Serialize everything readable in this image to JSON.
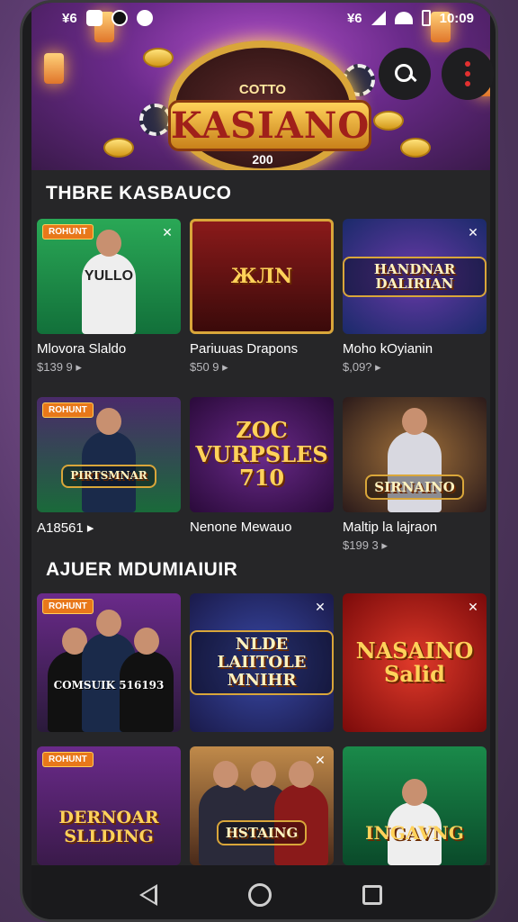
{
  "status_bar": {
    "left_text": "¥6",
    "time": "10:09",
    "right_text": "¥6",
    "icons": [
      "app-icon",
      "record-icon",
      "settings-icon",
      "signal-icon",
      "wifi-icon",
      "battery-icon"
    ]
  },
  "hero": {
    "logo_small": "COTTO",
    "logo_main": "KASIANO",
    "logo_badge": "200"
  },
  "actions": {
    "search_icon": "search-icon",
    "menu_icon": "more-vert-icon"
  },
  "section1": {
    "title": "THBRE KASBAUCO",
    "cards": [
      {
        "badge": "ROHUNT",
        "thumb_text": "YULLO",
        "title": "Mlovora Slaldo",
        "price": "$139 9"
      },
      {
        "badge": "",
        "thumb_text": "ЖЛN",
        "title": "Pariuuas Drapons",
        "price": "$50 9"
      },
      {
        "badge": "",
        "thumb_text": "HANDNAR DALIRIAN",
        "title": "Moho kOyianin",
        "price": "$,09?"
      },
      {
        "badge": "ROHUNT",
        "thumb_text": "PIRTSMNAR",
        "title": "A18561",
        "price": ""
      },
      {
        "badge": "",
        "thumb_text": "ZOC VURPSLES 710",
        "title": "Nenone Mewauo",
        "price": ""
      },
      {
        "badge": "",
        "thumb_text": "SIRNAINO",
        "title": "Maltip la lajraon",
        "price": "$199 3"
      }
    ]
  },
  "section2": {
    "title": "AJUER MDUMIAIUIR",
    "cards": [
      {
        "badge": "ROHUNT",
        "thumb_text": "COMSUIK 516193"
      },
      {
        "badge": "",
        "thumb_text": "NLDE LAIITOLE MNIHR"
      },
      {
        "badge": "",
        "thumb_text": "NASAINO Salid"
      },
      {
        "badge": "ROHUNT",
        "thumb_text": "DERNOAR SLLDING"
      },
      {
        "badge": "",
        "thumb_text": "HSTAING"
      },
      {
        "badge": "",
        "thumb_text": "INGAVNG"
      }
    ]
  },
  "nav": {
    "back_icon": "back-icon",
    "home_icon": "home-icon",
    "recent_icon": "recent-apps-icon"
  }
}
